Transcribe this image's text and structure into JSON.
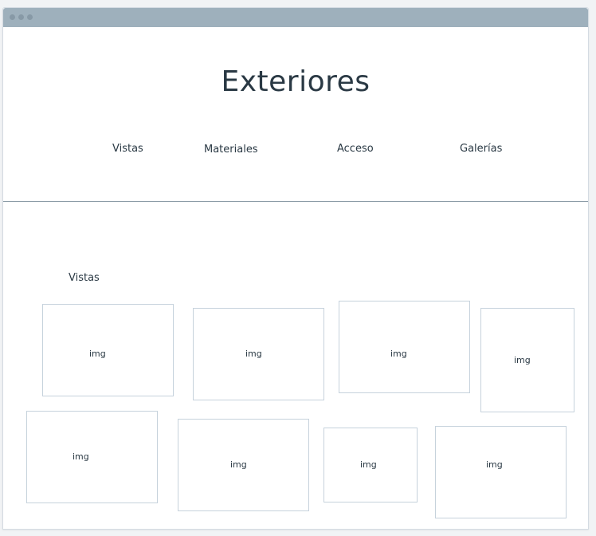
{
  "header": {
    "title": "Exteriores"
  },
  "nav": {
    "items": [
      {
        "label": "Vistas"
      },
      {
        "label": "Materiales"
      },
      {
        "label": "Acceso"
      },
      {
        "label": "Galerías"
      }
    ]
  },
  "section": {
    "title": "Vistas"
  },
  "gallery": {
    "placeholder": "img"
  },
  "colors": {
    "titlebar": "#9eb0bc",
    "text": "#2a3944",
    "placeholder_border": "#c6d2dc",
    "divider": "#8898a4"
  }
}
